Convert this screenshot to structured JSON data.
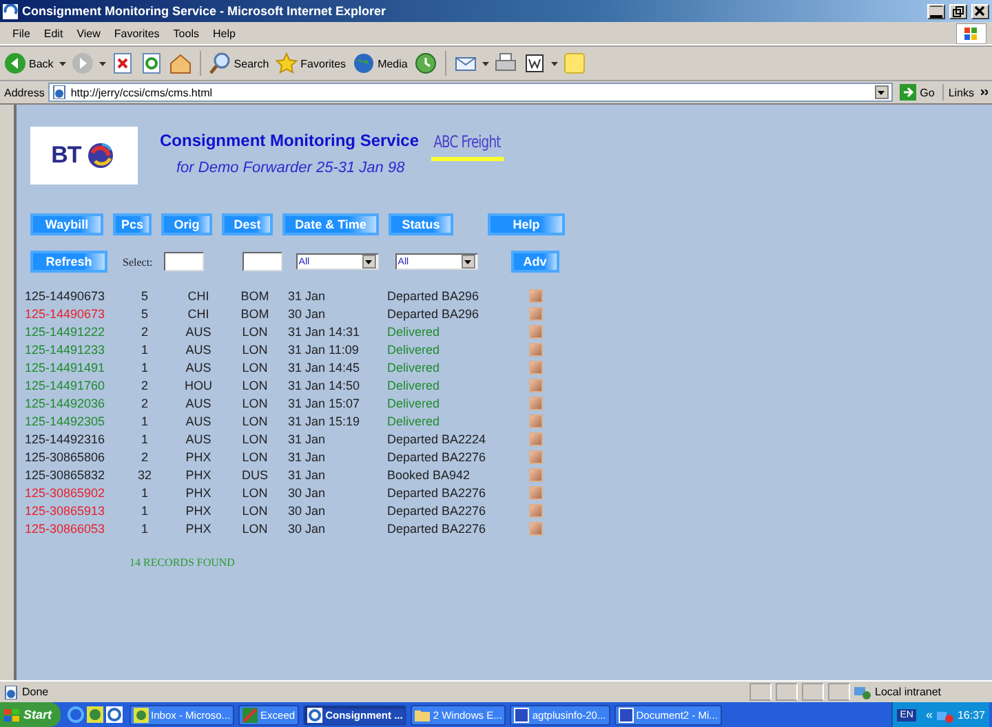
{
  "window": {
    "title": "Consignment Monitoring Service - Microsoft Internet Explorer"
  },
  "menu": [
    "File",
    "Edit",
    "View",
    "Favorites",
    "Tools",
    "Help"
  ],
  "toolbar": [
    {
      "kind": "back",
      "label": "Back"
    },
    {
      "kind": "forward"
    },
    {
      "kind": "stop"
    },
    {
      "kind": "refresh"
    },
    {
      "kind": "home"
    },
    {
      "kind": "search",
      "label": "Search"
    },
    {
      "kind": "favorites",
      "label": "Favorites"
    },
    {
      "kind": "media",
      "label": "Media"
    },
    {
      "kind": "history"
    },
    {
      "kind": "mail"
    },
    {
      "kind": "print"
    },
    {
      "kind": "word"
    },
    {
      "kind": "note"
    }
  ],
  "address": {
    "label": "Address",
    "url": "http://jerry/ccsi/cms/cms.html",
    "go": "Go",
    "links": "Links"
  },
  "header": {
    "logo": "BT",
    "title": "Consignment Monitoring Service",
    "subtitle": "for Demo Forwarder 25-31 Jan 98",
    "brand": "ABC Freight"
  },
  "column_buttons": [
    "Waybill",
    "Pcs",
    "Orig",
    "Dest",
    "Date & Time",
    "Status",
    "Help"
  ],
  "filter": {
    "refresh": "Refresh",
    "select_label": "Select:",
    "dropdowns": [
      "All",
      "All"
    ],
    "adv": "Adv"
  },
  "rows": [
    {
      "waybill": "125-14490673",
      "color": "#222222",
      "pcs": "5",
      "orig": "CHI",
      "dest": "BOM",
      "date": "31 Jan",
      "status": {
        "text": "Departed BA296",
        "color": "#222222"
      },
      "checked": false
    },
    {
      "waybill": "125-14490673",
      "color": "#e8202a",
      "pcs": "5",
      "orig": "CHI",
      "dest": "BOM",
      "date": "30 Jan",
      "status": {
        "text": "Departed BA296",
        "color": "#222222"
      },
      "checked": false
    },
    {
      "waybill": "125-14491222",
      "color": "#1e8c2a",
      "pcs": "2",
      "orig": "AUS",
      "dest": "LON",
      "date": "31 Jan 14:31",
      "status": {
        "text": "Delivered",
        "color": "#1e8c2a"
      },
      "checked": false
    },
    {
      "waybill": "125-14491233",
      "color": "#1e8c2a",
      "pcs": "1",
      "orig": "AUS",
      "dest": "LON",
      "date": "31 Jan 11:09",
      "status": {
        "text": "Delivered",
        "color": "#1e8c2a"
      },
      "checked": false
    },
    {
      "waybill": "125-14491491",
      "color": "#1e8c2a",
      "pcs": "1",
      "orig": "AUS",
      "dest": "LON",
      "date": "31 Jan 14:45",
      "status": {
        "text": "Delivered",
        "color": "#1e8c2a"
      },
      "checked": false
    },
    {
      "waybill": "125-14491760",
      "color": "#1e8c2a",
      "pcs": "2",
      "orig": "HOU",
      "dest": "LON",
      "date": "31 Jan 14:50",
      "status": {
        "text": "Delivered",
        "color": "#1e8c2a"
      },
      "checked": false
    },
    {
      "waybill": "125-14492036",
      "color": "#1e8c2a",
      "pcs": "2",
      "orig": "AUS",
      "dest": "LON",
      "date": "31 Jan 15:07",
      "status": {
        "text": "Delivered",
        "color": "#1e8c2a"
      },
      "checked": false
    },
    {
      "waybill": "125-14492305",
      "color": "#1e8c2a",
      "pcs": "1",
      "orig": "AUS",
      "dest": "LON",
      "date": "31 Jan 15:19",
      "status": {
        "text": "Delivered",
        "color": "#1e8c2a"
      },
      "checked": false
    },
    {
      "waybill": "125-14492316",
      "color": "#222222",
      "pcs": "1",
      "orig": "AUS",
      "dest": "LON",
      "date": "31 Jan",
      "status": {
        "text": "Departed BA2224",
        "color": "#222222"
      },
      "checked": false
    },
    {
      "waybill": "125-30865806",
      "color": "#222222",
      "pcs": "2",
      "orig": "PHX",
      "dest": "LON",
      "date": "31 Jan",
      "status": {
        "text": "Departed BA2276",
        "color": "#222222"
      },
      "checked": false
    },
    {
      "waybill": "125-30865832",
      "color": "#222222",
      "pcs": "32",
      "orig": "PHX",
      "dest": "DUS",
      "date": "31 Jan",
      "status": {
        "text": "Booked BA942",
        "color": "#222222"
      },
      "checked": false
    },
    {
      "waybill": "125-30865902",
      "color": "#e8202a",
      "pcs": "1",
      "orig": "PHX",
      "dest": "LON",
      "date": "30 Jan",
      "status": {
        "text": "Departed BA2276",
        "color": "#222222"
      },
      "checked": false
    },
    {
      "waybill": "125-30865913",
      "color": "#e8202a",
      "pcs": "1",
      "orig": "PHX",
      "dest": "LON",
      "date": "30 Jan",
      "status": {
        "text": "Departed BA2276",
        "color": "#222222"
      },
      "checked": false
    },
    {
      "waybill": "125-30866053",
      "color": "#e8202a",
      "pcs": "1",
      "orig": "PHX",
      "dest": "LON",
      "date": "30 Jan",
      "status": {
        "text": "Departed BA2276",
        "color": "#222222"
      },
      "checked": false
    }
  ],
  "records_found": "14 RECORDS FOUND",
  "status_bar": {
    "text": "Done",
    "zone": "Local intranet"
  },
  "taskbar": {
    "start": "Start",
    "tasks": [
      {
        "label": "Inbox - Microso...",
        "selected": false
      },
      {
        "label": "Exceed",
        "selected": false
      },
      {
        "label": "Consignment ...",
        "selected": true
      },
      {
        "label": "2 Windows E...",
        "selected": false
      },
      {
        "label": "agtplusinfo-20...",
        "selected": false
      },
      {
        "label": "Document2 - Mi...",
        "selected": false
      }
    ],
    "language": "EN",
    "tray_toggle": "«",
    "clock": "16:37"
  }
}
